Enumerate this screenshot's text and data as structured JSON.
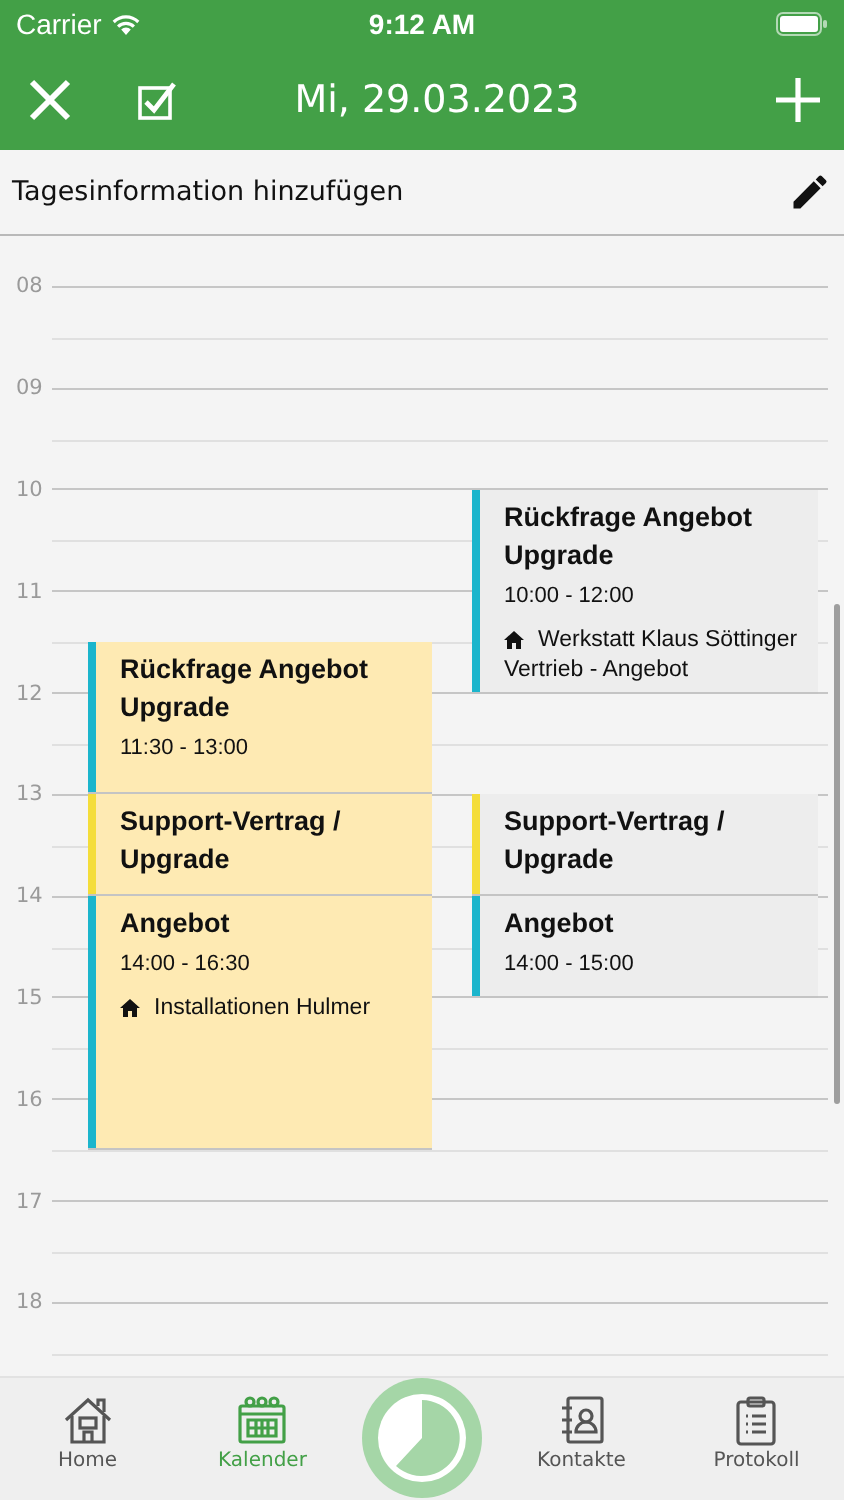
{
  "status_bar": {
    "carrier": "Carrier",
    "time": "9:12 AM"
  },
  "nav_bar": {
    "title": "Mi, 29.03.2023"
  },
  "day_info": {
    "label": "Tagesinformation hinzufügen"
  },
  "calendar": {
    "hours": [
      "08",
      "09",
      "10",
      "11",
      "12",
      "13",
      "14",
      "15",
      "16",
      "17",
      "18"
    ],
    "columns": [
      {
        "events": [
          {
            "title": "Rückfrage Angebot Upgrade",
            "time": "11:30 - 13:00",
            "tinted": true,
            "color": "#1bb5cc"
          },
          {
            "title": "Support-Vertrag / Upgrade",
            "tinted": true,
            "color": "#f4dd3a"
          },
          {
            "title": "Angebot",
            "time": "14:00 - 16:30",
            "location": "Installationen Hulmer",
            "tinted": true,
            "color": "#1bb5cc"
          }
        ]
      },
      {
        "events": [
          {
            "title": "Rückfrage Angebot Upgrade",
            "time": "10:00 - 12:00",
            "location": "Werkstatt Klaus Söttinger",
            "note": "Vertrieb - Angebot",
            "tinted": false,
            "color": "#1bb5cc"
          },
          {
            "title": "Support-Vertrag / Upgrade",
            "tinted": false,
            "color": "#f4dd3a"
          },
          {
            "title": "Angebot",
            "time": "14:00 - 15:00",
            "tinted": false,
            "color": "#1bb5cc"
          }
        ]
      }
    ]
  },
  "tab_bar": {
    "items": [
      {
        "kind": "home",
        "label": "Home",
        "selected": false
      },
      {
        "kind": "calendar",
        "label": "Kalender",
        "selected": true
      },
      {
        "kind": "timer"
      },
      {
        "kind": "contacts",
        "label": "Kontakte",
        "selected": false
      },
      {
        "kind": "log",
        "label": "Protokoll",
        "selected": false
      }
    ]
  }
}
